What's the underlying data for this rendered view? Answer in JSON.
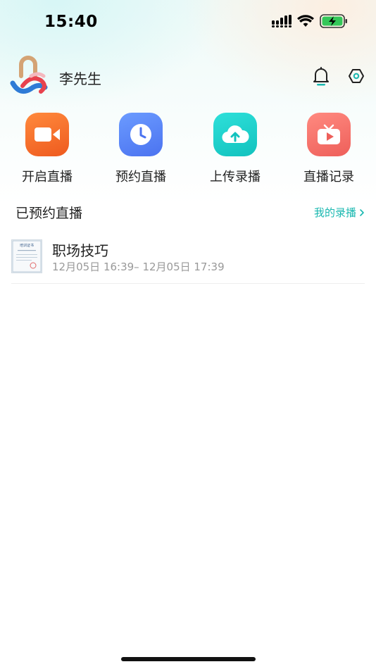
{
  "status_bar": {
    "time": "15:40",
    "icons": [
      "cellular-signal-icon",
      "wifi-icon",
      "battery-charging-icon"
    ]
  },
  "header": {
    "avatar_icon": "app-logo-avatar",
    "username": "李先生",
    "bell_icon": "bell-icon",
    "settings_icon": "settings-hexagon-icon"
  },
  "quick_actions": [
    {
      "label": "开启直播",
      "icon": "video-camera-icon",
      "color": "#F26A2A"
    },
    {
      "label": "预约直播",
      "icon": "clock-icon",
      "color": "#5B86F5"
    },
    {
      "label": "上传录播",
      "icon": "cloud-upload-icon",
      "color": "#1FCFCB"
    },
    {
      "label": "直播记录",
      "icon": "tv-play-icon",
      "color": "#F0706A"
    }
  ],
  "section": {
    "title": "已预约直播",
    "link_label": "我的录播",
    "link_icon": "chevron-right-icon",
    "accent_color": "#1AB8B0"
  },
  "scheduled_list": [
    {
      "title": "职场技巧",
      "time_range": "12月05日 16:39– 12月05日 17:39",
      "thumbnail_icon": "certificate-thumbnail",
      "thumbnail_text": "培训证书"
    }
  ]
}
